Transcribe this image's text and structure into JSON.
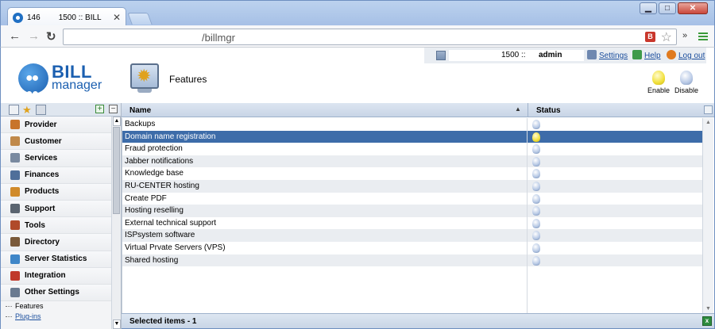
{
  "browser": {
    "tab_count": "146",
    "tab_title": "1500 :: BILL",
    "tab_close": "✕",
    "url": "/billmgr",
    "ext_badge": "B",
    "overflow": "»",
    "window_buttons": {
      "minimize": "▁",
      "maximize": "□",
      "close": "✕"
    }
  },
  "userbar": {
    "account_id": "1500 ::",
    "username": "admin",
    "settings": "Settings",
    "help": "Help",
    "logout": "Log out"
  },
  "logo": {
    "line1": "BILL",
    "line2": "manager"
  },
  "page_title": "Features",
  "actions": {
    "enable": "Enable",
    "disable": "Disable"
  },
  "sidebar": {
    "items": [
      {
        "label": "Provider",
        "color": "#c8742a"
      },
      {
        "label": "Customer",
        "color": "#c0894a"
      },
      {
        "label": "Services",
        "color": "#7a8aa0"
      },
      {
        "label": "Finances",
        "color": "#4f6f9a"
      },
      {
        "label": "Products",
        "color": "#d08a2a"
      },
      {
        "label": "Support",
        "color": "#5a6470"
      },
      {
        "label": "Tools",
        "color": "#b04a2a"
      },
      {
        "label": "Directory",
        "color": "#7a5a3a"
      },
      {
        "label": "Server Statistics",
        "color": "#3f86c8"
      },
      {
        "label": "Integration",
        "color": "#c0392b"
      },
      {
        "label": "Other Settings",
        "color": "#6a7a90"
      }
    ],
    "sub_items": [
      {
        "label": "Features"
      },
      {
        "label": "Plug-ins"
      }
    ]
  },
  "table": {
    "columns": {
      "name": "Name",
      "status": "Status"
    },
    "rows": [
      {
        "name": "Backups",
        "status": "off"
      },
      {
        "name": "Domain name registration",
        "status": "on"
      },
      {
        "name": "Fraud protection",
        "status": "off"
      },
      {
        "name": "Jabber notifications",
        "status": "off"
      },
      {
        "name": "Knowledge base",
        "status": "off"
      },
      {
        "name": "RU-CENTER hosting",
        "status": "off"
      },
      {
        "name": "Create PDF",
        "status": "off"
      },
      {
        "name": "Hosting reselling",
        "status": "off"
      },
      {
        "name": "External technical support",
        "status": "off"
      },
      {
        "name": "ISPsystem software",
        "status": "off"
      },
      {
        "name": "Virtual Prvate Servers (VPS)",
        "status": "off"
      },
      {
        "name": "Shared hosting",
        "status": "off"
      }
    ],
    "selected_index": 1,
    "footer": "Selected items - 1"
  }
}
